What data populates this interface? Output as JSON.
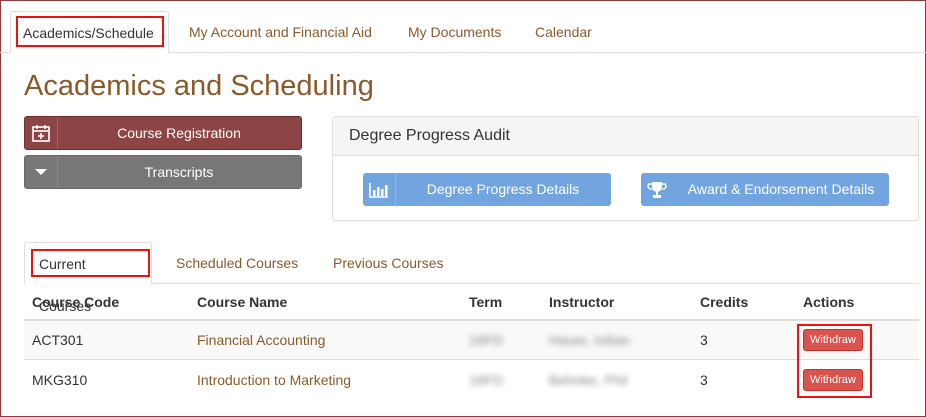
{
  "top_tabs": [
    "Academics/Schedule",
    "My Account and Financial Aid",
    "My Documents",
    "Calendar"
  ],
  "page_title": "Academics and Scheduling",
  "buttons": {
    "course_registration": "Course Registration",
    "transcripts": "Transcripts"
  },
  "degree_panel": {
    "title": "Degree Progress Audit",
    "progress_button": "Degree Progress Details",
    "award_button": "Award & Endorsement Details"
  },
  "course_tabs": [
    "Current Courses",
    "Scheduled Courses",
    "Previous Courses"
  ],
  "table": {
    "headers": [
      "Course Code",
      "Course Name",
      "Term",
      "Instructor",
      "Credits",
      "Actions"
    ],
    "rows": [
      {
        "code": "ACT301",
        "name": "Financial Accounting",
        "term": "16FD",
        "instructor": "Hauer, Ivilian",
        "credits": "3",
        "action": "Withdraw"
      },
      {
        "code": "MKG310",
        "name": "Introduction to Marketing",
        "term": "16FD",
        "instructor": "Behnke, Phil",
        "credits": "3",
        "action": "Withdraw"
      }
    ]
  },
  "colors": {
    "brand_brown": "#8b5a2b",
    "registration_red": "#8c4444",
    "transcript_gray": "#777777",
    "panel_blue": "#72a4e0",
    "withdraw_red": "#d9534f",
    "highlight_box": "#ee1111"
  },
  "icons": [
    "calendar-plus-icon",
    "caret-down-icon",
    "bar-chart-icon",
    "trophy-icon"
  ]
}
